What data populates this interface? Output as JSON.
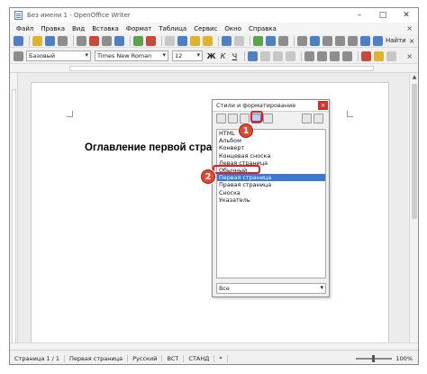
{
  "window": {
    "title": "Без имени 1 - OpenOffice Writer",
    "controls": [
      "–",
      "□",
      "✕"
    ]
  },
  "menu": [
    "Файл",
    "Правка",
    "Вид",
    "Вставка",
    "Формат",
    "Таблица",
    "Сервис",
    "Окно",
    "Справка"
  ],
  "menu_close": "×",
  "toolbar": {
    "find_label": "Найти",
    "close": "×",
    "paragraph_style": "Базовый",
    "font_name": "Times New Roman",
    "font_size": "12",
    "bold": "Ж",
    "italic": "К",
    "underline": "Ч"
  },
  "document": {
    "heading": "Оглавление первой страницы"
  },
  "styles_panel": {
    "title": "Стили и форматирование",
    "close": "×",
    "items": [
      "HTML",
      "Альбом",
      "Конверт",
      "Концевая сноска",
      "Левая страница",
      "Обычный",
      "Первая страница",
      "Правая страница",
      "Сноска",
      "Указатель"
    ],
    "selected_index": 6,
    "filter_value": "Все"
  },
  "callouts": [
    "1",
    "2"
  ],
  "status": {
    "page": "Страница 1 / 1",
    "page_style": "Первая страница",
    "language": "Русский",
    "insert_mode": "ВСТ",
    "selection_mode": "СТАНД",
    "modified": "*",
    "zoom": "100%"
  },
  "colors": {
    "callout": "#e04a33",
    "highlight": "#d6222a",
    "selection": "#3b78d4"
  }
}
